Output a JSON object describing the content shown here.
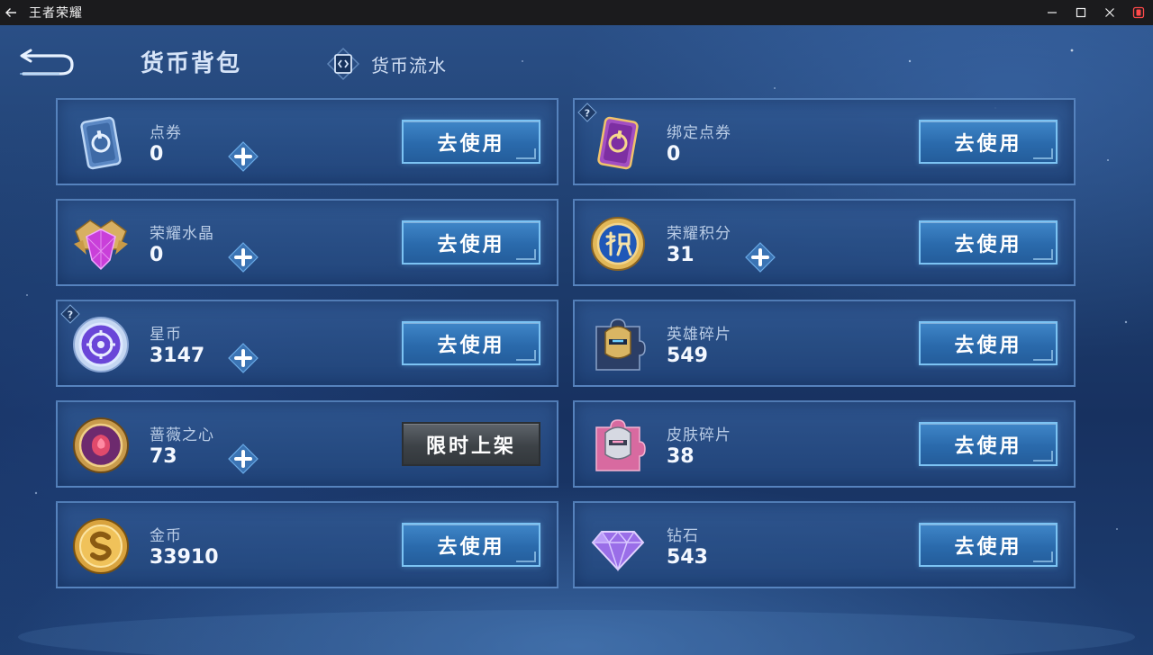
{
  "window": {
    "title": "王者荣耀"
  },
  "header": {
    "title": "货币背包",
    "flow_label": "货币流水"
  },
  "colors": {
    "accent": "#2a6aac",
    "panel": "#2c5a92",
    "button_border": "#7cc3f3",
    "disabled_button": "#3d4247"
  },
  "currencies": [
    {
      "name": "点券",
      "value": "0",
      "icon": "coupon-card-icon",
      "button": "去使用",
      "has_plus": true,
      "has_help": false
    },
    {
      "name": "绑定点券",
      "value": "0",
      "icon": "bound-coupon-card-icon",
      "button": "去使用",
      "has_plus": false,
      "has_help": true
    },
    {
      "name": "荣耀水晶",
      "value": "0",
      "icon": "glory-crystal-icon",
      "button": "去使用",
      "has_plus": true,
      "has_help": false
    },
    {
      "name": "荣耀积分",
      "value": "31",
      "icon": "glory-points-icon",
      "button": "去使用",
      "has_plus": true,
      "has_help": false
    },
    {
      "name": "星币",
      "value": "3147",
      "icon": "star-coin-icon",
      "button": "去使用",
      "has_plus": true,
      "has_help": true
    },
    {
      "name": "英雄碎片",
      "value": "549",
      "icon": "hero-shard-icon",
      "button": "去使用",
      "has_plus": false,
      "has_help": false
    },
    {
      "name": "蔷薇之心",
      "value": "73",
      "icon": "rose-heart-icon",
      "button": "限时上架",
      "has_plus": true,
      "has_help": false
    },
    {
      "name": "皮肤碎片",
      "value": "38",
      "icon": "skin-shard-icon",
      "button": "去使用",
      "has_plus": false,
      "has_help": false
    },
    {
      "name": "金币",
      "value": "33910",
      "icon": "gold-coin-icon",
      "button": "去使用",
      "has_plus": false,
      "has_help": false
    },
    {
      "name": "钻石",
      "value": "543",
      "icon": "diamond-icon",
      "button": "去使用",
      "has_plus": false,
      "has_help": false
    }
  ]
}
